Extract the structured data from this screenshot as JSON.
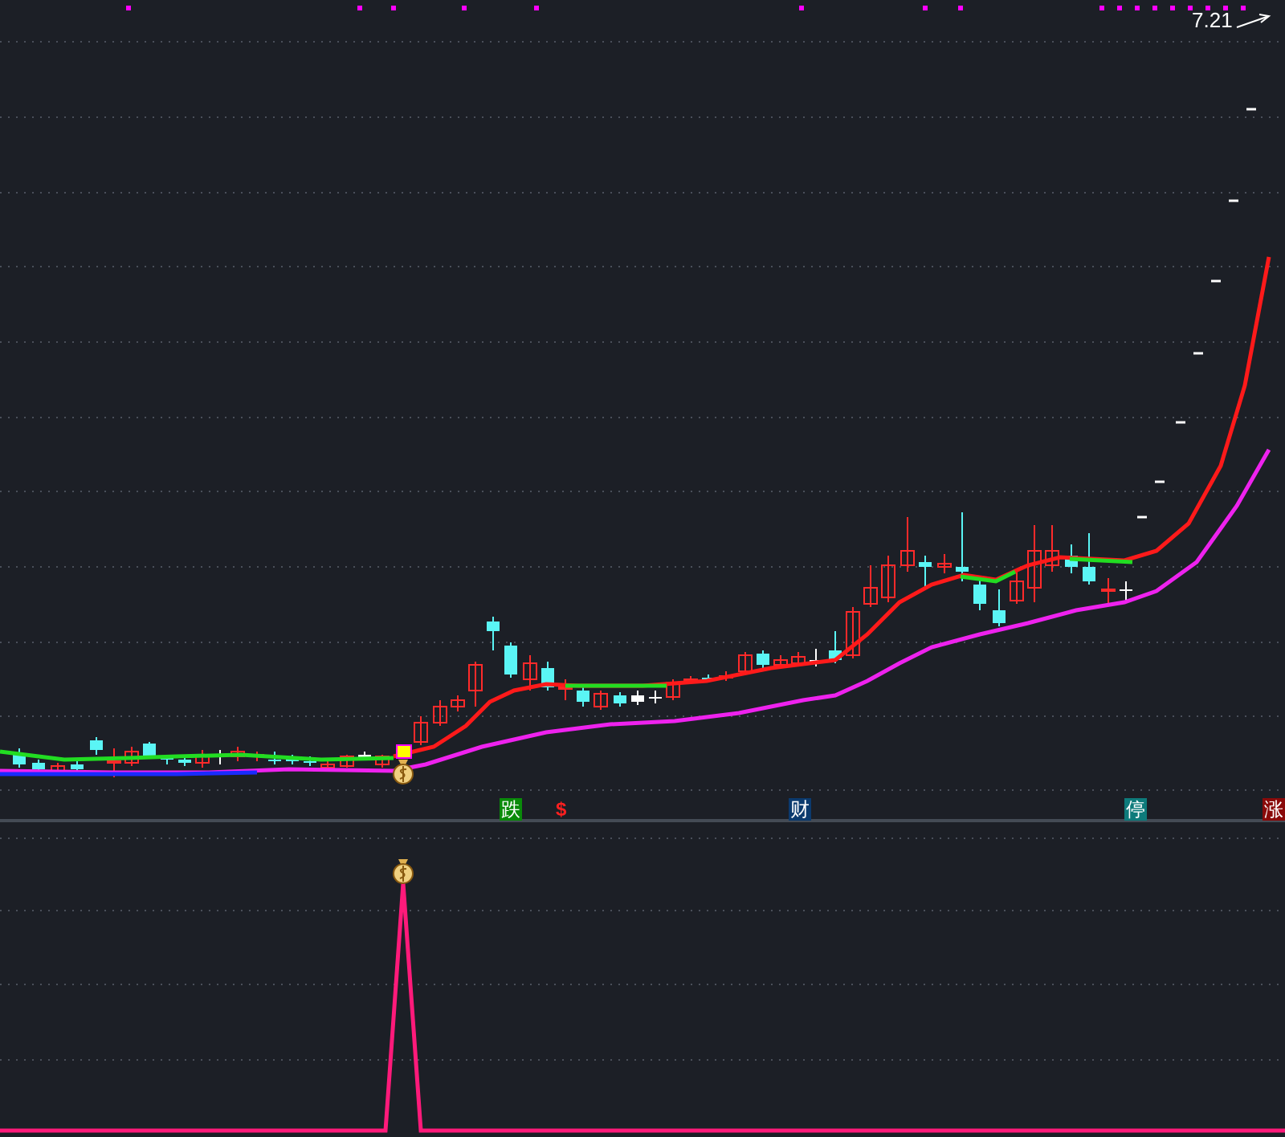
{
  "price_label": "7.21",
  "signals": [
    {
      "text": "跌",
      "kind": "tag",
      "color": "#0a8a0a"
    },
    {
      "text": "$",
      "kind": "glyph",
      "color": "#ff2020"
    },
    {
      "text": "财",
      "kind": "tag",
      "color": "#0b3a6e"
    },
    {
      "text": "停",
      "kind": "tag",
      "color": "#0e7b7b"
    },
    {
      "text": "涨",
      "kind": "tag",
      "color": "#8a0a0a"
    }
  ]
}
